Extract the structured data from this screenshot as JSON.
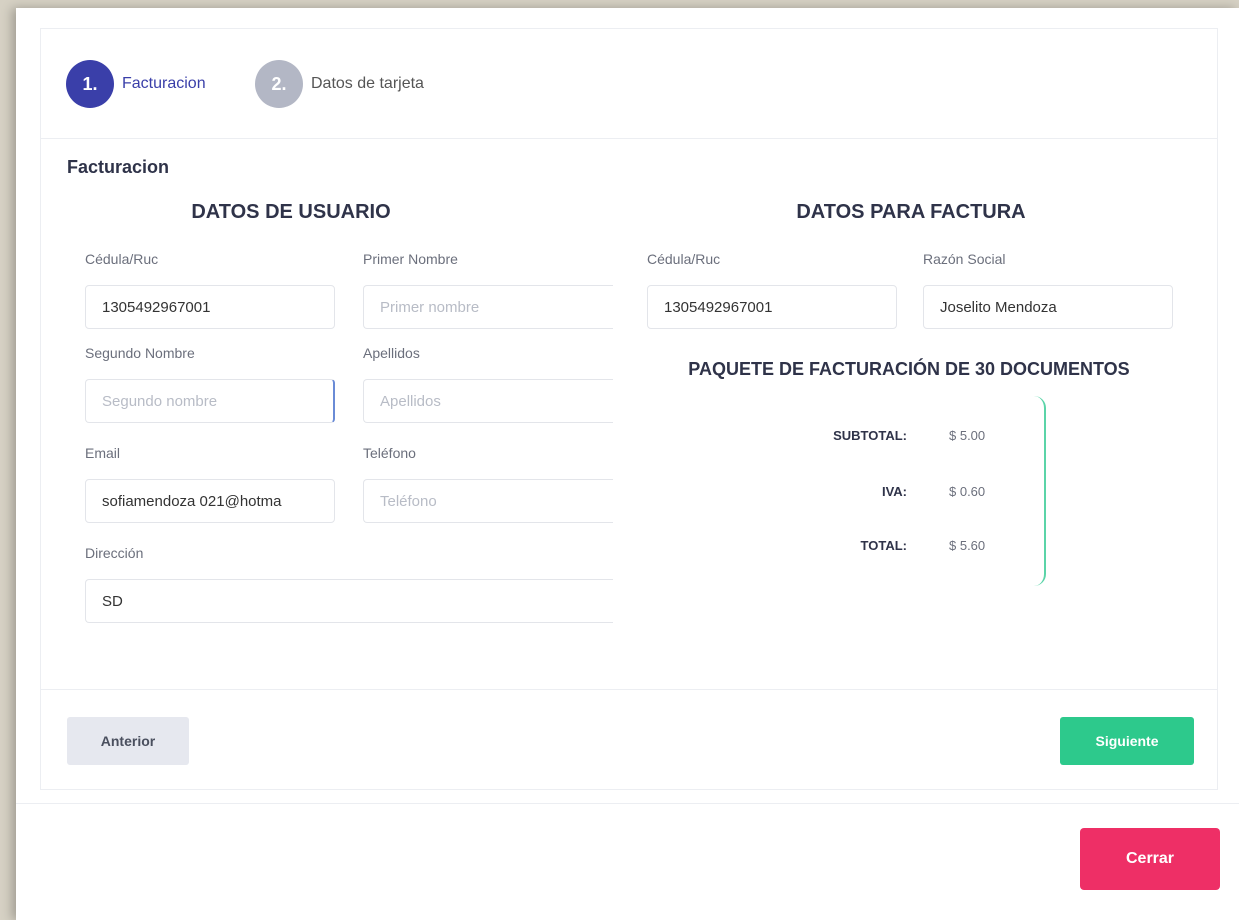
{
  "steps": [
    {
      "number": "1.",
      "label": "Facturacion"
    },
    {
      "number": "2.",
      "label": "Datos de tarjeta"
    }
  ],
  "section_title": "Facturacion",
  "user_data": {
    "heading": "DATOS DE USUARIO",
    "cedula_label": "Cédula/Ruc",
    "cedula_value": "1305492967001",
    "primer_nombre_label": "Primer Nombre",
    "primer_nombre_placeholder": "Primer nombre",
    "segundo_nombre_label": "Segundo Nombre",
    "segundo_nombre_placeholder": "Segundo nombre",
    "apellidos_label": "Apellidos",
    "apellidos_placeholder": "Apellidos",
    "email_label": "Email",
    "email_value": "sofiamendoza 021@hotma",
    "telefono_label": "Teléfono",
    "telefono_placeholder": "Teléfono",
    "direccion_label": "Dirección",
    "direccion_value": "SD"
  },
  "invoice_data": {
    "heading": "DATOS PARA FACTURA",
    "cedula_label": "Cédula/Ruc",
    "cedula_value": "1305492967001",
    "razon_social_label": "Razón Social",
    "razon_social_value": "Joselito Mendoza"
  },
  "package": {
    "title": "PAQUETE DE FACTURACIÓN DE 30 DOCUMENTOS",
    "subtotal_label": "SUBTOTAL:",
    "subtotal_value": "$ 5.00",
    "iva_label": "IVA:",
    "iva_value": "$ 0.60",
    "total_label": "TOTAL:",
    "total_value": "$ 5.60"
  },
  "buttons": {
    "prev": "Anterior",
    "next": "Siguiente",
    "close": "Cerrar"
  },
  "colors": {
    "accent": "#3a3fa9",
    "success": "#2dc98c",
    "danger": "#ee2f66"
  }
}
